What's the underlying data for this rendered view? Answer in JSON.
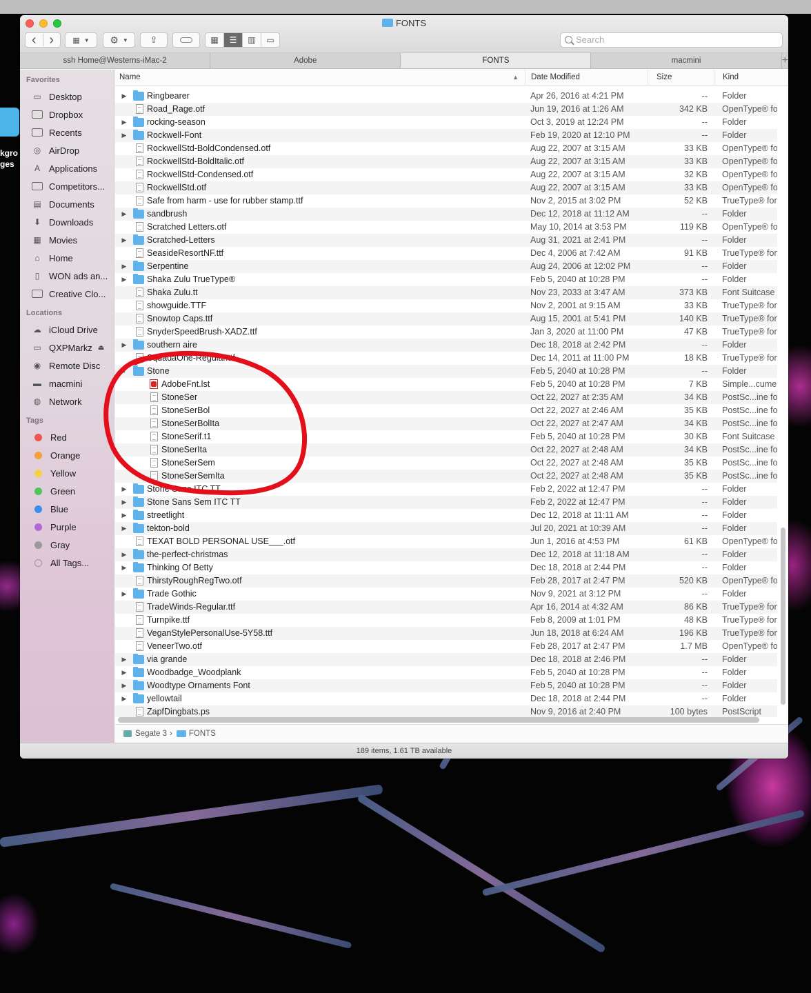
{
  "desktop": {
    "partial_label_line1": "kgro",
    "partial_label_line2": "ges"
  },
  "window": {
    "title": "FONTS"
  },
  "toolbar": {
    "back_glyph": "‹",
    "forward_glyph": "›",
    "view_options_icon": "grid-icon",
    "action_icon": "gear-icon",
    "share_icon": "share-icon",
    "tag_icon": "tag-icon",
    "view_modes": [
      "icon-view-icon",
      "list-view-icon",
      "column-view-icon",
      "gallery-view-icon"
    ],
    "active_view": "list"
  },
  "search": {
    "placeholder": "Search"
  },
  "tabs": [
    {
      "label": "ssh Home@Westerns-iMac-2"
    },
    {
      "label": "Adobe"
    },
    {
      "label": "FONTS",
      "active": true
    },
    {
      "label": "macmini"
    }
  ],
  "sidebar": {
    "favorites_header": "Favorites",
    "favorites": [
      {
        "label": "Desktop",
        "icon": "desktop-icon"
      },
      {
        "label": "Dropbox",
        "icon": "folder-icon"
      },
      {
        "label": "Recents",
        "icon": "folder-icon"
      },
      {
        "label": "AirDrop",
        "icon": "airdrop-icon"
      },
      {
        "label": "Applications",
        "icon": "applications-icon"
      },
      {
        "label": "Competitors...",
        "icon": "folder-icon"
      },
      {
        "label": "Documents",
        "icon": "documents-icon"
      },
      {
        "label": "Downloads",
        "icon": "downloads-icon"
      },
      {
        "label": "Movies",
        "icon": "movies-icon"
      },
      {
        "label": "Home",
        "icon": "home-icon"
      },
      {
        "label": "WON ads an...",
        "icon": "document-icon"
      },
      {
        "label": "Creative Clo...",
        "icon": "folder-icon"
      }
    ],
    "locations_header": "Locations",
    "locations": [
      {
        "label": "iCloud Drive",
        "icon": "cloud-icon"
      },
      {
        "label": "QXPMarkz",
        "icon": "drive-icon",
        "eject": true
      },
      {
        "label": "Remote Disc",
        "icon": "disc-icon"
      },
      {
        "label": "macmini",
        "icon": "computer-icon"
      },
      {
        "label": "Network",
        "icon": "network-icon"
      }
    ],
    "tags_header": "Tags",
    "tags": [
      {
        "label": "Red",
        "color": "#f0544f"
      },
      {
        "label": "Orange",
        "color": "#f5a03a"
      },
      {
        "label": "Yellow",
        "color": "#f7d23e"
      },
      {
        "label": "Green",
        "color": "#4fc45a"
      },
      {
        "label": "Blue",
        "color": "#3a8ef0"
      },
      {
        "label": "Purple",
        "color": "#b266d8"
      },
      {
        "label": "Gray",
        "color": "#9a9a9a"
      },
      {
        "label": "All Tags...",
        "color": ""
      }
    ]
  },
  "columns": {
    "name": "Name",
    "date": "Date Modified",
    "size": "Size",
    "kind": "Kind"
  },
  "files": [
    {
      "name": "Ringbearer",
      "date": "Apr 26, 2016 at 4:21 PM",
      "size": "--",
      "kind": "Folder",
      "type": "folder",
      "level": 0
    },
    {
      "name": "Road_Rage.otf",
      "date": "Jun 19, 2016 at 1:26 AM",
      "size": "342 KB",
      "kind": "OpenType® font",
      "type": "doc",
      "level": 0
    },
    {
      "name": "rocking-season",
      "date": "Oct 3, 2019 at 12:24 PM",
      "size": "--",
      "kind": "Folder",
      "type": "folder",
      "level": 0
    },
    {
      "name": "Rockwell-Font",
      "date": "Feb 19, 2020 at 12:10 PM",
      "size": "--",
      "kind": "Folder",
      "type": "folder",
      "level": 0
    },
    {
      "name": "RockwellStd-BoldCondensed.otf",
      "date": "Aug 22, 2007 at 3:15 AM",
      "size": "33 KB",
      "kind": "OpenType® font",
      "type": "doc",
      "level": 0
    },
    {
      "name": "RockwellStd-BoldItalic.otf",
      "date": "Aug 22, 2007 at 3:15 AM",
      "size": "33 KB",
      "kind": "OpenType® font",
      "type": "doc",
      "level": 0
    },
    {
      "name": "RockwellStd-Condensed.otf",
      "date": "Aug 22, 2007 at 3:15 AM",
      "size": "32 KB",
      "kind": "OpenType® font",
      "type": "doc",
      "level": 0
    },
    {
      "name": "RockwellStd.otf",
      "date": "Aug 22, 2007 at 3:15 AM",
      "size": "33 KB",
      "kind": "OpenType® font",
      "type": "doc",
      "level": 0
    },
    {
      "name": "Safe from harm - use for rubber stamp.ttf",
      "date": "Nov 2, 2015 at 3:02 PM",
      "size": "52 KB",
      "kind": "TrueType® font",
      "type": "doc",
      "level": 0
    },
    {
      "name": "sandbrush",
      "date": "Dec 12, 2018 at 11:12 AM",
      "size": "--",
      "kind": "Folder",
      "type": "folder",
      "level": 0
    },
    {
      "name": "Scratched Letters.otf",
      "date": "May 10, 2014 at 3:53 PM",
      "size": "119 KB",
      "kind": "OpenType® font",
      "type": "doc",
      "level": 0
    },
    {
      "name": "Scratched-Letters",
      "date": "Aug 31, 2021 at 2:41 PM",
      "size": "--",
      "kind": "Folder",
      "type": "folder",
      "level": 0
    },
    {
      "name": "SeasideResortNF.ttf",
      "date": "Dec 4, 2006 at 7:42 AM",
      "size": "91 KB",
      "kind": "TrueType® font",
      "type": "doc",
      "level": 0
    },
    {
      "name": "Serpentine",
      "date": "Aug 24, 2006 at 12:02 PM",
      "size": "--",
      "kind": "Folder",
      "type": "folder",
      "level": 0
    },
    {
      "name": "Shaka Zulu TrueType®",
      "date": "Feb 5, 2040 at 10:28 PM",
      "size": "--",
      "kind": "Folder",
      "type": "folder",
      "level": 0
    },
    {
      "name": "Shaka Zulu.tt",
      "date": "Nov 23, 2033 at 3:47 AM",
      "size": "373 KB",
      "kind": "Font Suitcase",
      "type": "doc",
      "level": 0
    },
    {
      "name": "showguide.TTF",
      "date": "Nov 2, 2001 at 9:15 AM",
      "size": "33 KB",
      "kind": "TrueType® font",
      "type": "doc",
      "level": 0
    },
    {
      "name": "Snowtop Caps.ttf",
      "date": "Aug 15, 2001 at 5:41 PM",
      "size": "140 KB",
      "kind": "TrueType® font",
      "type": "doc",
      "level": 0
    },
    {
      "name": "SnyderSpeedBrush-XADZ.ttf",
      "date": "Jan 3, 2020 at 11:00 PM",
      "size": "47 KB",
      "kind": "TrueType® font",
      "type": "doc",
      "level": 0
    },
    {
      "name": "southern aire",
      "date": "Dec 18, 2018 at 2:42 PM",
      "size": "--",
      "kind": "Folder",
      "type": "folder",
      "level": 0
    },
    {
      "name": "SquadaOne-Regular.ttf",
      "date": "Dec 14, 2011 at 11:00 PM",
      "size": "18 KB",
      "kind": "TrueType® font",
      "type": "doc",
      "level": 0
    },
    {
      "name": "Stone",
      "date": "Feb 5, 2040 at 10:28 PM",
      "size": "--",
      "kind": "Folder",
      "type": "folder",
      "level": 0,
      "open": true
    },
    {
      "name": "AdobeFnt.lst",
      "date": "Feb 5, 2040 at 10:28 PM",
      "size": "7 KB",
      "kind": "Simple...cument",
      "type": "pdf",
      "level": 1
    },
    {
      "name": "StoneSer",
      "date": "Oct 22, 2027 at 2:35 AM",
      "size": "34 KB",
      "kind": "PostSc...ine font",
      "type": "doc",
      "level": 1
    },
    {
      "name": "StoneSerBol",
      "date": "Oct 22, 2027 at 2:46 AM",
      "size": "35 KB",
      "kind": "PostSc...ine font",
      "type": "doc",
      "level": 1
    },
    {
      "name": "StoneSerBolIta",
      "date": "Oct 22, 2027 at 2:47 AM",
      "size": "34 KB",
      "kind": "PostSc...ine font",
      "type": "doc",
      "level": 1
    },
    {
      "name": "StoneSerif.t1",
      "date": "Feb 5, 2040 at 10:28 PM",
      "size": "30 KB",
      "kind": "Font Suitcase",
      "type": "doc",
      "level": 1
    },
    {
      "name": "StoneSerIta",
      "date": "Oct 22, 2027 at 2:48 AM",
      "size": "34 KB",
      "kind": "PostSc...ine font",
      "type": "doc",
      "level": 1
    },
    {
      "name": "StoneSerSem",
      "date": "Oct 22, 2027 at 2:48 AM",
      "size": "35 KB",
      "kind": "PostSc...ine font",
      "type": "doc",
      "level": 1
    },
    {
      "name": "StoneSerSemIta",
      "date": "Oct 22, 2027 at 2:48 AM",
      "size": "35 KB",
      "kind": "PostSc...ine font",
      "type": "doc",
      "level": 1
    },
    {
      "name": "Stone Sans ITC TT",
      "date": "Feb 2, 2022 at 12:47 PM",
      "size": "--",
      "kind": "Folder",
      "type": "folder",
      "level": 0
    },
    {
      "name": "Stone Sans Sem ITC TT",
      "date": "Feb 2, 2022 at 12:47 PM",
      "size": "--",
      "kind": "Folder",
      "type": "folder",
      "level": 0
    },
    {
      "name": "streetlight",
      "date": "Dec 12, 2018 at 11:11 AM",
      "size": "--",
      "kind": "Folder",
      "type": "folder",
      "level": 0
    },
    {
      "name": "tekton-bold",
      "date": "Jul 20, 2021 at 10:39 AM",
      "size": "--",
      "kind": "Folder",
      "type": "folder",
      "level": 0
    },
    {
      "name": "TEXAT BOLD PERSONAL USE___.otf",
      "date": "Jun 1, 2016 at 4:53 PM",
      "size": "61 KB",
      "kind": "OpenType® font",
      "type": "doc",
      "level": 0
    },
    {
      "name": "the-perfect-christmas",
      "date": "Dec 12, 2018 at 11:18 AM",
      "size": "--",
      "kind": "Folder",
      "type": "folder",
      "level": 0
    },
    {
      "name": "Thinking Of Betty",
      "date": "Dec 18, 2018 at 2:44 PM",
      "size": "--",
      "kind": "Folder",
      "type": "folder",
      "level": 0
    },
    {
      "name": "ThirstyRoughRegTwo.otf",
      "date": "Feb 28, 2017 at 2:47 PM",
      "size": "520 KB",
      "kind": "OpenType® font",
      "type": "doc",
      "level": 0
    },
    {
      "name": "Trade Gothic",
      "date": "Nov 9, 2021 at 3:12 PM",
      "size": "--",
      "kind": "Folder",
      "type": "folder",
      "level": 0
    },
    {
      "name": "TradeWinds-Regular.ttf",
      "date": "Apr 16, 2014 at 4:32 AM",
      "size": "86 KB",
      "kind": "TrueType® font",
      "type": "doc",
      "level": 0
    },
    {
      "name": "Turnpike.ttf",
      "date": "Feb 8, 2009 at 1:01 PM",
      "size": "48 KB",
      "kind": "TrueType® font",
      "type": "doc",
      "level": 0
    },
    {
      "name": "VeganStylePersonalUse-5Y58.ttf",
      "date": "Jun 18, 2018 at 6:24 AM",
      "size": "196 KB",
      "kind": "TrueType® font",
      "type": "doc",
      "level": 0
    },
    {
      "name": "VeneerTwo.otf",
      "date": "Feb 28, 2017 at 2:47 PM",
      "size": "1.7 MB",
      "kind": "OpenType® font",
      "type": "doc",
      "level": 0
    },
    {
      "name": "via grande",
      "date": "Dec 18, 2018 at 2:46 PM",
      "size": "--",
      "kind": "Folder",
      "type": "folder",
      "level": 0
    },
    {
      "name": "Woodbadge_Woodplank",
      "date": "Feb 5, 2040 at 10:28 PM",
      "size": "--",
      "kind": "Folder",
      "type": "folder",
      "level": 0
    },
    {
      "name": "Woodtype Ornaments Font",
      "date": "Feb 5, 2040 at 10:28 PM",
      "size": "--",
      "kind": "Folder",
      "type": "folder",
      "level": 0
    },
    {
      "name": "yellowtail",
      "date": "Dec 18, 2018 at 2:44 PM",
      "size": "--",
      "kind": "Folder",
      "type": "folder",
      "level": 0
    },
    {
      "name": "ZapfDingbats.ps",
      "date": "Nov 9, 2016 at 2:40 PM",
      "size": "100 bytes",
      "kind": "PostScript",
      "type": "doc",
      "level": 0
    }
  ],
  "pathbar": {
    "drive": "Segate 3",
    "separator": "›",
    "folder": "FONTS"
  },
  "status": "189 items, 1.61 TB available",
  "annotation_color": "#e3101c"
}
